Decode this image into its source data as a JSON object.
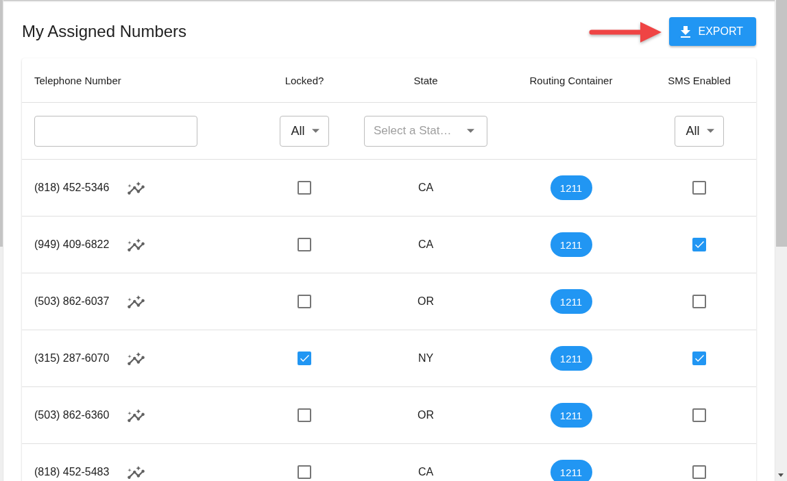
{
  "title": "My Assigned Numbers",
  "export_button": {
    "label": "EXPORT"
  },
  "table": {
    "columns": [
      {
        "label": "Telephone Number",
        "filter": {
          "kind": "text"
        }
      },
      {
        "label": "Locked?",
        "filter": {
          "kind": "select",
          "value": "All"
        }
      },
      {
        "label": "State",
        "filter": {
          "kind": "select",
          "placeholder": "Select a Stat…"
        }
      },
      {
        "label": "Routing Container"
      },
      {
        "label": "SMS Enabled",
        "filter": {
          "kind": "select",
          "value": "All"
        }
      }
    ],
    "rows": [
      {
        "telephone_number": "(818) 452-5346",
        "locked": false,
        "state": "CA",
        "routing_container": "1211",
        "sms_enabled": false
      },
      {
        "telephone_number": "(949) 409-6822",
        "locked": false,
        "state": "CA",
        "routing_container": "1211",
        "sms_enabled": true
      },
      {
        "telephone_number": "(503) 862-6037",
        "locked": false,
        "state": "OR",
        "routing_container": "1211",
        "sms_enabled": false
      },
      {
        "telephone_number": "(315) 287-6070",
        "locked": true,
        "state": "NY",
        "routing_container": "1211",
        "sms_enabled": true
      },
      {
        "telephone_number": "(503) 862-6360",
        "locked": false,
        "state": "OR",
        "routing_container": "1211",
        "sms_enabled": false
      },
      {
        "telephone_number": "(818) 452-5483",
        "locked": false,
        "state": "CA",
        "routing_container": "1211",
        "sms_enabled": false
      }
    ]
  }
}
